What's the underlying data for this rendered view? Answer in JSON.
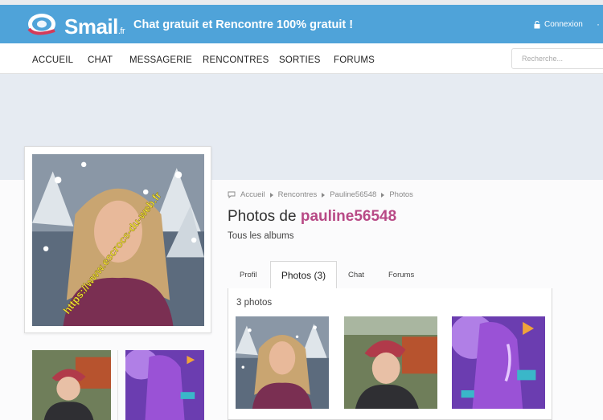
{
  "header": {
    "logo_text": "Smail",
    "logo_suffix": ".fr",
    "tagline": "Chat gratuit et Rencontre 100% gratuit !",
    "login_label": "Connexion",
    "more_label": "·"
  },
  "nav": {
    "items": [
      "ACCUEIL",
      "CHAT",
      "MESSAGERIE",
      "RENCONTRES",
      "SORTIES",
      "FORUMS"
    ],
    "search_placeholder": "Recherche..."
  },
  "breadcrumb": [
    "Accueil",
    "Rencontres",
    "Pauline56548",
    "Photos"
  ],
  "page": {
    "title_prefix": "Photos de ",
    "username": "pauline56548",
    "subtitle": "Tous les albums"
  },
  "tabs": [
    "Profil",
    "Photos (3)",
    "Chat",
    "Forums"
  ],
  "active_tab": "Photos (3)",
  "album": {
    "count_label": "3 photos",
    "photos": [
      "portrait-snow",
      "selfie-cap",
      "fantasy-purple"
    ]
  },
  "watermark": "https://www.escrocs-du-web.fr",
  "colors": {
    "header_bg": "#4fa3d9",
    "username": "#b84a86",
    "banner": "#e6ebf2"
  }
}
